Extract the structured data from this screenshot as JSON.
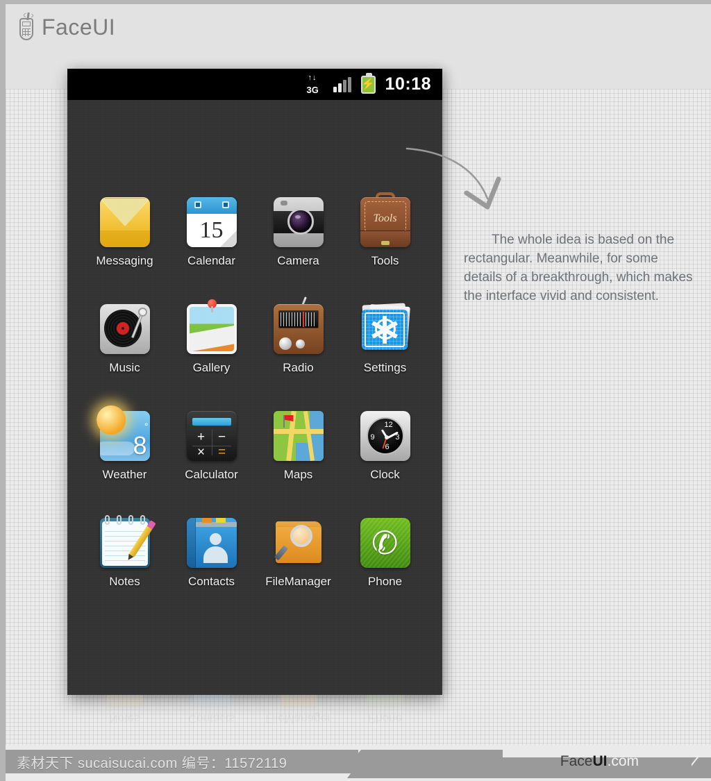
{
  "brand": {
    "name": "FaceUI",
    "icon": "phone-logo-icon"
  },
  "statusbar": {
    "network_arrows": "↑↓",
    "network_label": "3G",
    "signal_icon": "signal-bars-icon",
    "battery_icon": "battery-charging-icon",
    "battery_bolt": "⚡",
    "time": "10:18"
  },
  "apps": [
    [
      {
        "label": "Messaging",
        "icon": "messaging-icon"
      },
      {
        "label": "Calendar",
        "icon": "calendar-icon",
        "day": "15"
      },
      {
        "label": "Camera",
        "icon": "camera-icon"
      },
      {
        "label": "Tools",
        "icon": "tools-icon",
        "badge_text": "Tools"
      }
    ],
    [
      {
        "label": "Music",
        "icon": "music-icon"
      },
      {
        "label": "Gallery",
        "icon": "gallery-icon"
      },
      {
        "label": "Radio",
        "icon": "radio-icon"
      },
      {
        "label": "Settings",
        "icon": "settings-icon"
      }
    ],
    [
      {
        "label": "Weather",
        "icon": "weather-icon",
        "temp": "8",
        "degree": "°"
      },
      {
        "label": "Calculator",
        "icon": "calculator-icon",
        "keys": [
          "+",
          "−",
          "×",
          "="
        ]
      },
      {
        "label": "Maps",
        "icon": "maps-icon"
      },
      {
        "label": "Clock",
        "icon": "clock-icon",
        "numerals": [
          "12",
          "3",
          "6",
          "9"
        ]
      }
    ],
    [
      {
        "label": "Notes",
        "icon": "notes-icon"
      },
      {
        "label": "Contacts",
        "icon": "contacts-icon"
      },
      {
        "label": "FileManager",
        "icon": "file-manager-icon"
      },
      {
        "label": "Phone",
        "icon": "phone-icon",
        "glyph": "✆"
      }
    ]
  ],
  "reflection_labels": [
    "Notes",
    "Contacts",
    "FileManager",
    "Phone"
  ],
  "annotation": {
    "arrow_icon": "curved-arrow-icon",
    "text": "The whole idea is based on the rectangular. Meanwhile, for some details of a breakthrough, which makes the interface vivid and consistent."
  },
  "footer": {
    "watermark_left": "素材天下 sucaisucai.com  编号：11572119",
    "brand_a": "Face",
    "brand_b": "UI",
    "brand_c": ".com"
  },
  "colors": {
    "page_bg": "#eaeaea",
    "phone_bg": "#333333",
    "statusbar_bg": "#000000",
    "battery_green": "#8fc33a",
    "accent_blue": "#1896e8",
    "footer_bar": "#9a9a9a",
    "text_gray": "#6f7276"
  }
}
